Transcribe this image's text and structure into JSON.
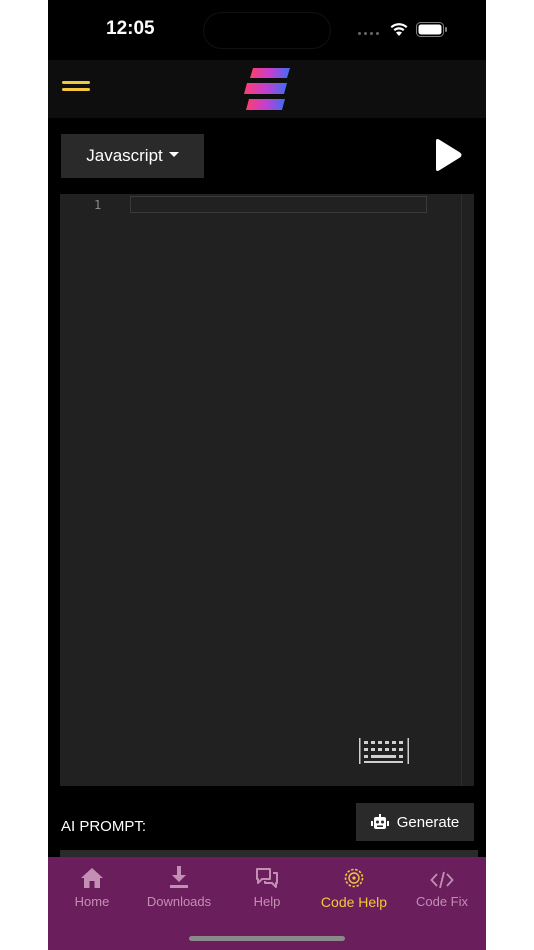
{
  "status_bar": {
    "time": "12:05"
  },
  "editor": {
    "language_label": "Javascript",
    "line_number": "1"
  },
  "prompt": {
    "label": "AI PROMPT:",
    "generate_label": "Generate",
    "input_value": ""
  },
  "tabs": [
    {
      "label": "Home",
      "icon": "home-icon"
    },
    {
      "label": "Downloads",
      "icon": "download-icon"
    },
    {
      "label": "Help",
      "icon": "chat-bubbles-icon"
    },
    {
      "label": "Code Help",
      "icon": "ai-gear-icon",
      "active": true
    },
    {
      "label": "Code Fix",
      "icon": "code-icon"
    }
  ],
  "colors": {
    "accent": "#f4c73b",
    "tabbar": "#6a1e5c",
    "tab_inactive": "#c48fb4",
    "editor_bg": "#212121"
  }
}
